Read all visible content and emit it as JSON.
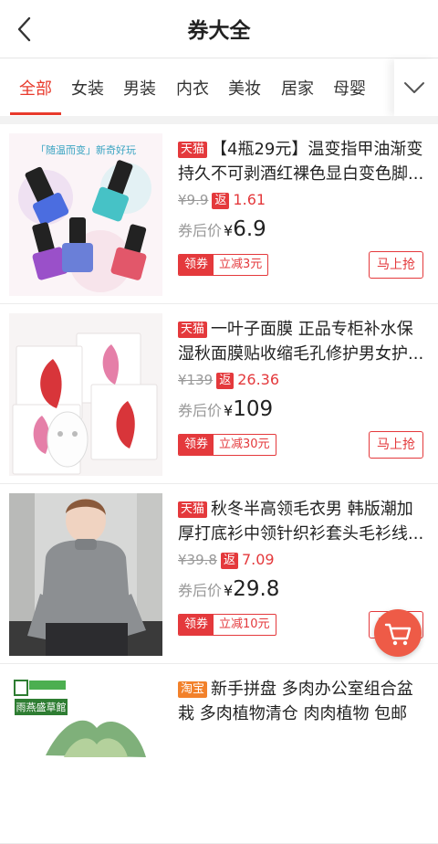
{
  "header": {
    "title": "券大全",
    "back_icon": "chevron-left-icon"
  },
  "tabs": [
    {
      "label": "全部",
      "active": true
    },
    {
      "label": "女装",
      "active": false
    },
    {
      "label": "男装",
      "active": false
    },
    {
      "label": "内衣",
      "active": false
    },
    {
      "label": "美妆",
      "active": false
    },
    {
      "label": "居家",
      "active": false
    },
    {
      "label": "母婴",
      "active": false
    }
  ],
  "tabs_more_icon": "chevron-down-icon",
  "labels": {
    "final_price": "券后价",
    "currency": "¥",
    "coupon": "领券",
    "buy": "马上抢",
    "rebate": "返"
  },
  "products": [
    {
      "shop_badge": "天猫",
      "title": "【4瓶29元】温变指甲油渐变持久不可剥酒红裸色显白变色脚...",
      "original_price": "¥9.9",
      "rebate": "1.61",
      "final_price": "6.9",
      "coupon": "立减3元",
      "thumb_text": "「随温而变」新奇好玩"
    },
    {
      "shop_badge": "天猫",
      "title": "一叶子面膜 正品专柜补水保湿秋面膜贴收缩毛孔修护男女护...",
      "original_price": "¥139",
      "rebate": "26.36",
      "final_price": "109",
      "coupon": "立减30元",
      "thumb_text": ""
    },
    {
      "shop_badge": "天猫",
      "title": "秋冬半高领毛衣男 韩版潮加厚打底衫中领针织衫套头毛衫线...",
      "original_price": "¥39.8",
      "rebate": "7.09",
      "final_price": "29.8",
      "coupon": "立减10元",
      "thumb_text": ""
    },
    {
      "shop_badge": "淘宝",
      "title": "新手拼盘 多肉办公室组合盆栽 多肉植物清仓 肉肉植物 包邮",
      "thumb_text": "雨燕盛草館"
    }
  ],
  "colors": {
    "accent": "#e4393c",
    "tab_active": "#e83a2c",
    "taobao": "#f2812b",
    "fab": "#ee5b47"
  },
  "fab_icon": "shopping-cart-icon"
}
